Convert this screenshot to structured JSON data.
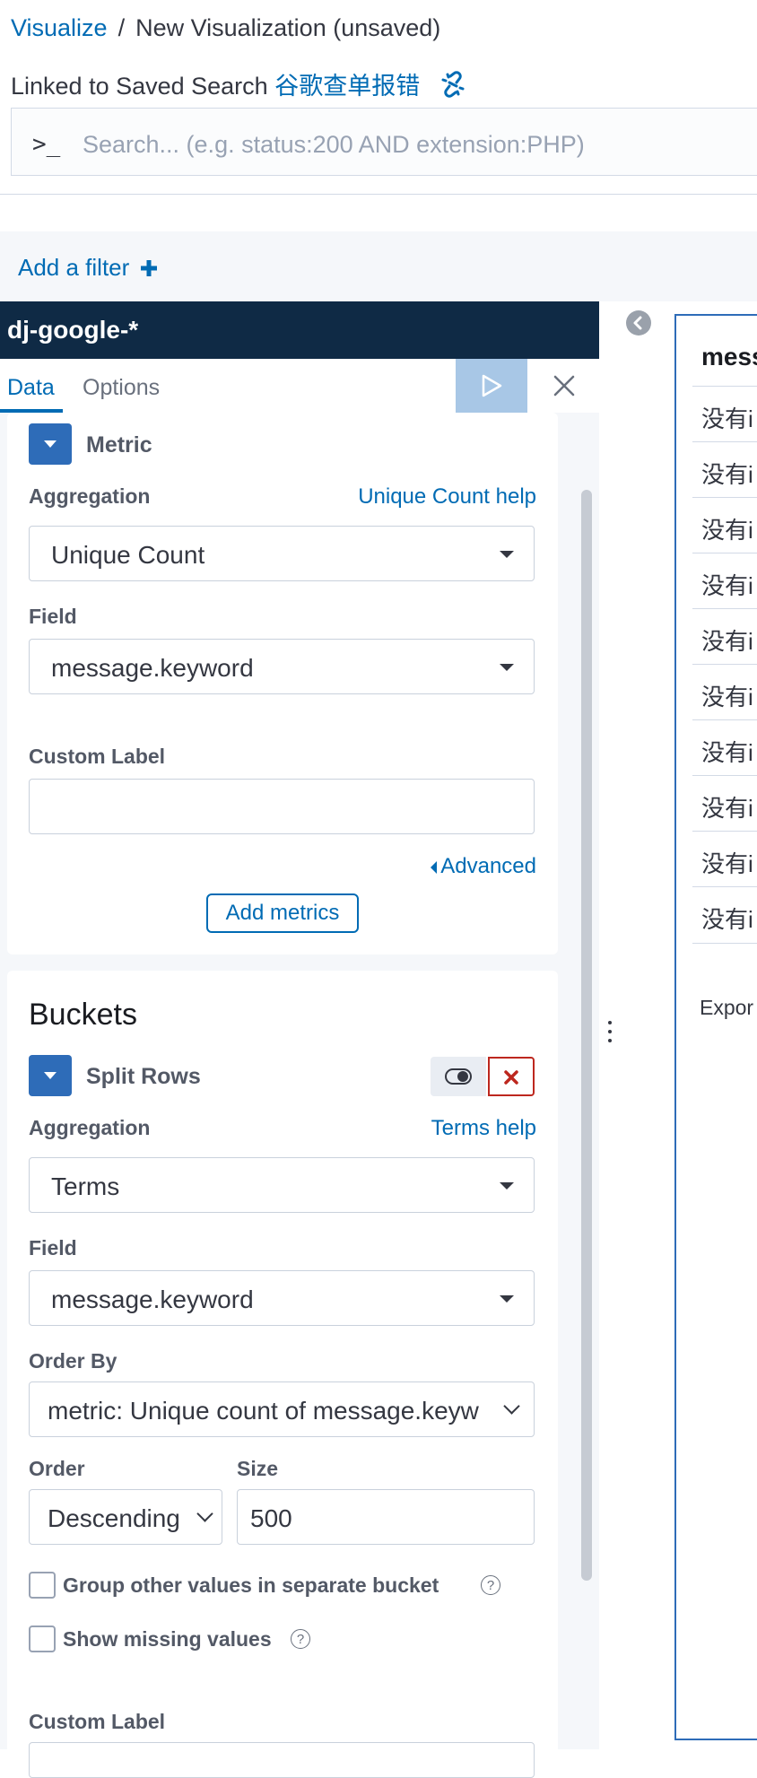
{
  "header": {
    "breadcrumb_root": "Visualize",
    "breadcrumb_sep": "/",
    "breadcrumb_current": "New Visualization (unsaved)",
    "linked_prefix": "Linked to Saved Search",
    "linked_search_name": "谷歌查单报错"
  },
  "search": {
    "prompt": ">_",
    "placeholder": "Search... (e.g. status:200 AND extension:PHP)"
  },
  "filter": {
    "add_label": "Add a filter"
  },
  "sidebar": {
    "index_pattern": "dj-google-*",
    "tabs": [
      {
        "label": "Data",
        "active": true
      },
      {
        "label": "Options",
        "active": false
      }
    ],
    "metric": {
      "title": "Metric",
      "aggregation_label": "Aggregation",
      "aggregation_help": "Unique Count help",
      "aggregation_value": "Unique Count",
      "field_label": "Field",
      "field_value": "message.keyword",
      "custom_label_label": "Custom Label",
      "custom_label_value": "",
      "advanced_label": "Advanced",
      "add_metrics_label": "Add metrics"
    },
    "buckets": {
      "title": "Buckets",
      "split_title": "Split Rows",
      "aggregation_label": "Aggregation",
      "aggregation_help": "Terms help",
      "aggregation_value": "Terms",
      "field_label": "Field",
      "field_value": "message.keyword",
      "order_by_label": "Order By",
      "order_by_value": "metric: Unique count of message.keyw",
      "order_label": "Order",
      "order_value": "Descending",
      "size_label": "Size",
      "size_value": "500",
      "group_other_label": "Group other values in separate bucket",
      "group_other_checked": false,
      "show_missing_label": "Show missing values",
      "show_missing_checked": false,
      "custom_label_label": "Custom Label"
    }
  },
  "table": {
    "header": "mess",
    "rows": [
      "没有i",
      "没有i",
      "没有i",
      "没有i",
      "没有i",
      "没有i",
      "没有i",
      "没有i",
      "没有i",
      "没有i"
    ],
    "export_label": "Expor"
  },
  "colors": {
    "link": "#006bb4",
    "header_bg": "#0f2a45",
    "apply_btn": "#a8c7e6",
    "toggle_blue": "#2e6cb8",
    "delete_red": "#bd271e"
  },
  "icons": {
    "linked_search": "unlink-icon",
    "add_filter": "plus-icon",
    "apply": "play-icon",
    "close": "close-icon",
    "collapse": "chevron-left-circle-icon",
    "advanced": "caret-left-icon",
    "toggle": "toggle-icon",
    "delete": "cross-icon"
  }
}
